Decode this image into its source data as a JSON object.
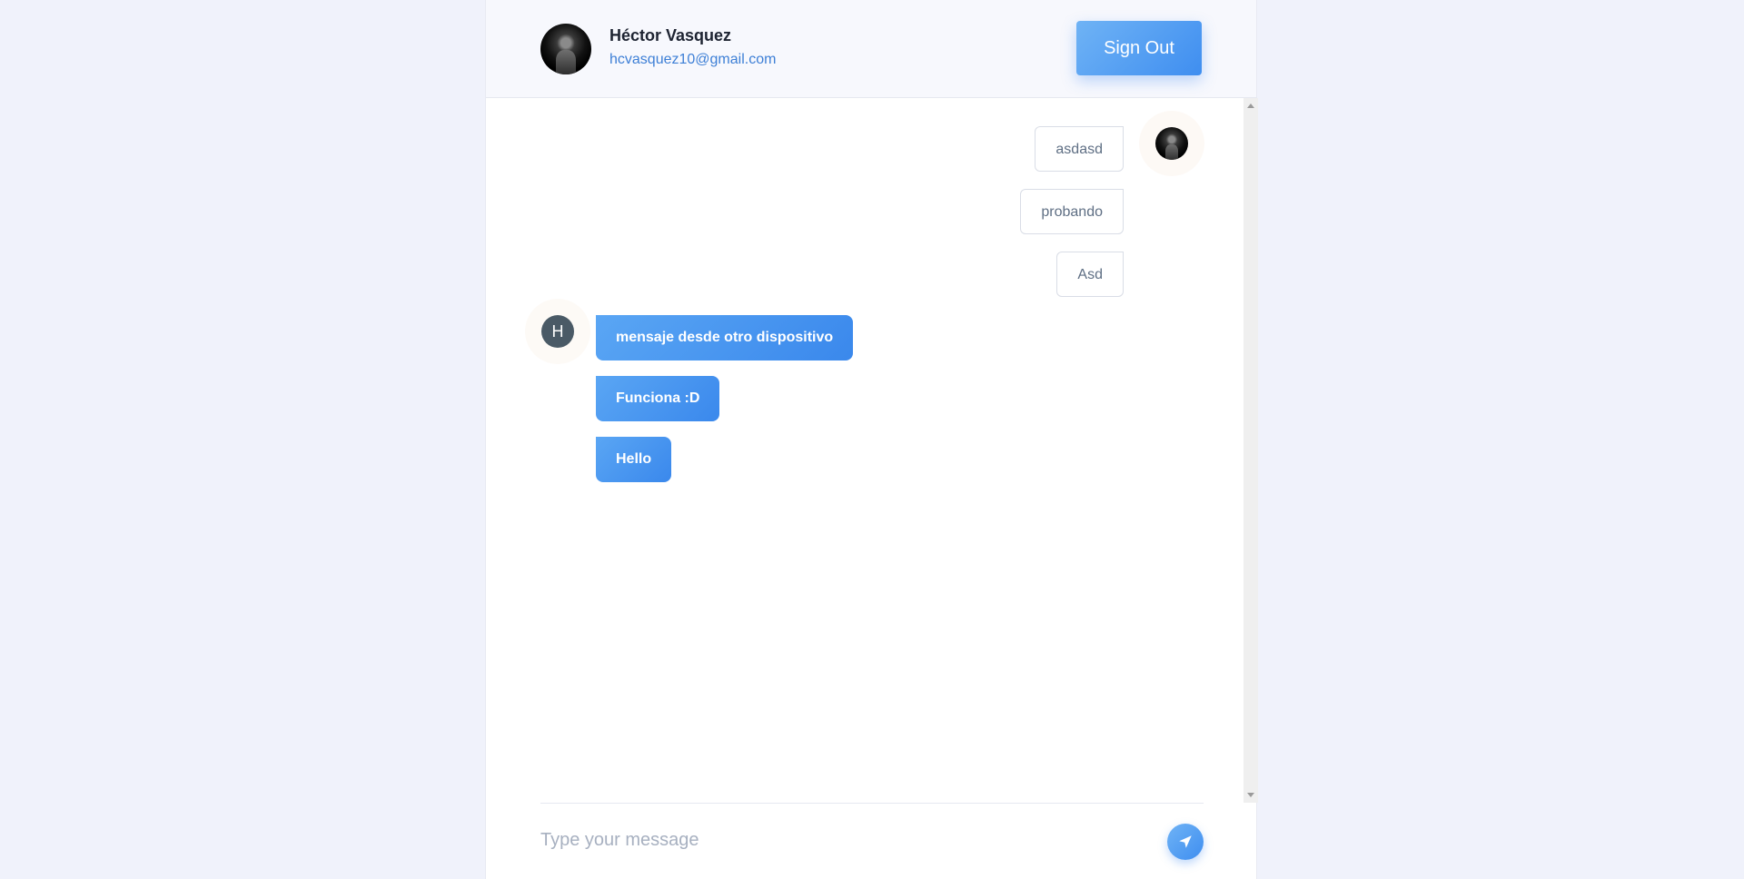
{
  "user": {
    "name": "Héctor Vasquez",
    "email": "hcvasquez10@gmail.com"
  },
  "header": {
    "signout_label": "Sign Out"
  },
  "messages": {
    "outgoing": [
      "asdasd",
      "probando",
      "Asd"
    ],
    "incoming_avatar_initial": "H",
    "incoming": [
      "mensaje desde otro dispositivo",
      "Funciona :D",
      "Hello"
    ]
  },
  "composer": {
    "placeholder": "Type your message",
    "send_icon": "paper-plane-icon"
  },
  "colors": {
    "accent": "#3f8ef0",
    "background": "#f0f2fb"
  }
}
